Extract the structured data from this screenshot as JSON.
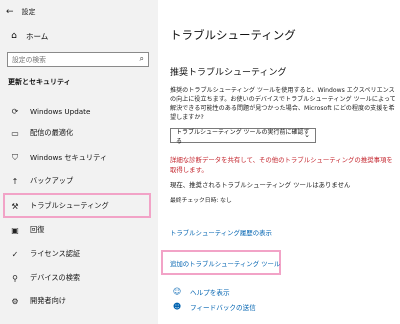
{
  "window": {
    "back_glyph": "←",
    "title": "設定"
  },
  "sidebar": {
    "home": {
      "icon": "home-icon",
      "label": "ホーム"
    },
    "search": {
      "placeholder": "設定の検索"
    },
    "section": "更新とセキュリティ",
    "items": [
      {
        "label": "Windows Update",
        "icon": "sync-icon"
      },
      {
        "label": "配信の最適化",
        "icon": "delivery-optimization-icon"
      },
      {
        "label": "Windows セキュリティ",
        "icon": "shield-icon"
      },
      {
        "label": "バックアップ",
        "icon": "backup-arrow-icon"
      },
      {
        "label": "トラブルシューティング",
        "icon": "wrench-icon"
      },
      {
        "label": "回復",
        "icon": "recovery-icon"
      },
      {
        "label": "ライセンス認証",
        "icon": "activation-check-icon"
      },
      {
        "label": "デバイスの検索",
        "icon": "find-device-icon"
      },
      {
        "label": "開発者向け",
        "icon": "developer-icon"
      }
    ]
  },
  "main": {
    "title": "トラブルシューティング",
    "subtitle": "推奨トラブルシューティング",
    "description": "推奨のトラブルシューティング ツールを使用すると、Windows エクスペリエンスの向上に役立ちます。お使いのデバイスでトラブルシューティング ツールによって解決できる可能性のある問題が見つかった場合、Microsoft にどの程度の支援を希望しますか?",
    "dropdown_value": "トラブルシューティング ツールの実行前に確認する",
    "warning": "詳細な診断データを共有して、その他のトラブルシューティングの推奨事項を取得します。",
    "status": "現在、推奨されるトラブルシューティング ツールはありません",
    "last_check": "最終チェック日時: なし",
    "link_history": "トラブルシューティング履歴の表示",
    "link_extra": "追加のトラブルシューティング ツール",
    "help": {
      "icon": "help-icon",
      "label": "ヘルプを表示"
    },
    "feedback": {
      "icon": "feedback-icon",
      "label": "フィードバックの送信"
    }
  },
  "colors": {
    "accent_link": "#0063b1",
    "warning": "#c4262e",
    "highlight": "#f2a3c7",
    "sidebar_bg": "#f2f2f2"
  }
}
